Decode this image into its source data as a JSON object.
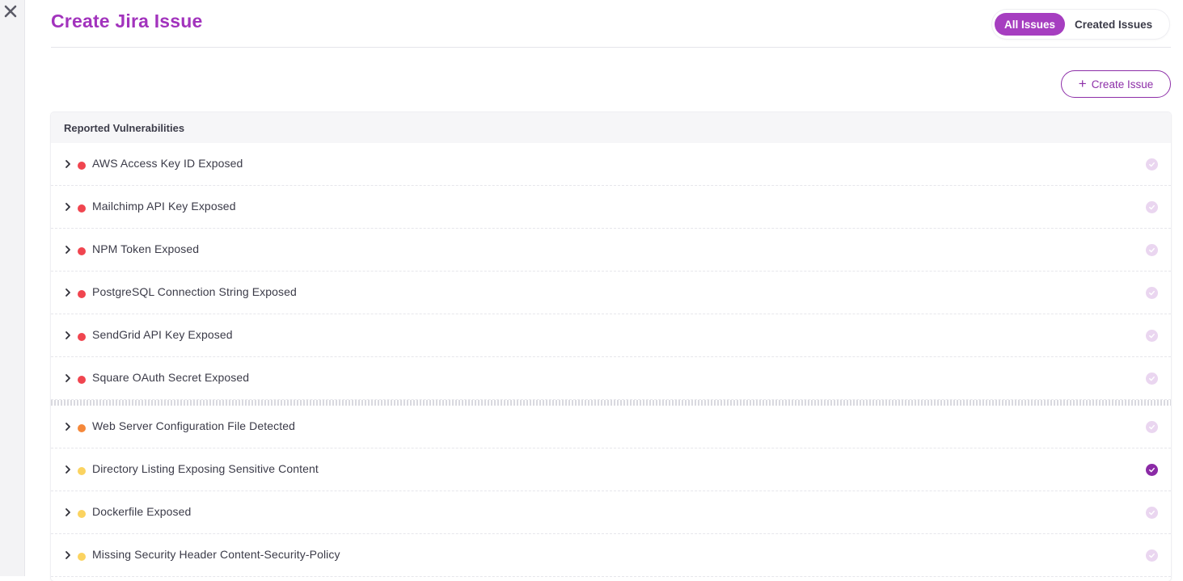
{
  "header": {
    "title": "Create Jira Issue",
    "tabs": [
      {
        "label": "All Issues",
        "active": true
      },
      {
        "label": "Created Issues",
        "active": false
      }
    ]
  },
  "actions": {
    "create_label": "Create Issue"
  },
  "table": {
    "heading": "Reported Vulnerabilities",
    "rows": [
      {
        "title": "AWS Access Key ID Exposed",
        "severity": "critical",
        "severity_color": "#f0454f",
        "selected": false
      },
      {
        "title": "Mailchimp API Key Exposed",
        "severity": "critical",
        "severity_color": "#f0454f",
        "selected": false
      },
      {
        "title": "NPM Token Exposed",
        "severity": "critical",
        "severity_color": "#f0454f",
        "selected": false
      },
      {
        "title": "PostgreSQL Connection String Exposed",
        "severity": "critical",
        "severity_color": "#f0454f",
        "selected": false
      },
      {
        "title": "SendGrid API Key Exposed",
        "severity": "critical",
        "severity_color": "#f0454f",
        "selected": false
      },
      {
        "title": "Square OAuth Secret Exposed",
        "severity": "critical",
        "severity_color": "#f0454f",
        "selected": false
      },
      {
        "title": "Web Server Configuration File Detected",
        "severity": "high",
        "severity_color": "#f5883a",
        "selected": false
      },
      {
        "title": "Directory Listing Exposing Sensitive Content",
        "severity": "medium",
        "severity_color": "#fbd360",
        "selected": true
      },
      {
        "title": "Dockerfile Exposed",
        "severity": "medium",
        "severity_color": "#fbd360",
        "selected": false
      },
      {
        "title": "Missing Security Header Content-Security-Policy",
        "severity": "medium",
        "severity_color": "#fbd360",
        "selected": false
      }
    ]
  },
  "colors": {
    "brand": "#a233bd",
    "accent_dark": "#8b2aa6",
    "check_off": "#ead6f0"
  },
  "icons": {
    "close": "close-icon",
    "plus": "plus-icon",
    "chevron": "chevron-right-icon",
    "check": "check-circle-icon"
  }
}
